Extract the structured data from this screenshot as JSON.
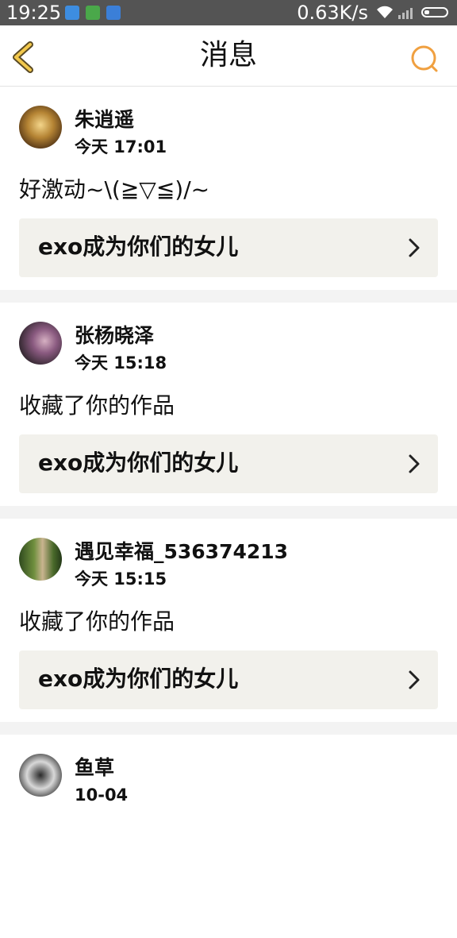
{
  "status_bar": {
    "time": "19:25",
    "speed": "0.63K/s",
    "icons": [
      "notification-app-icon",
      "notification-app-icon",
      "notification-shield-icon",
      "wifi-icon",
      "signal-icon",
      "battery-icon"
    ]
  },
  "header": {
    "title": "消息",
    "back_icon": "chevron-left-icon",
    "search_icon": "search-icon",
    "accent_color": "#f0a040"
  },
  "messages": [
    {
      "name": "朱逍遥",
      "time": "今天 17:01",
      "text": "好激动~\\(≧▽≦)/~",
      "work_title": "exo成为你们的女儿"
    },
    {
      "name": "张杨晓泽",
      "time": "今天 15:18",
      "text": "收藏了你的作品",
      "work_title": "exo成为你们的女儿"
    },
    {
      "name": "遇见幸福_536374213",
      "time": "今天 15:15",
      "text": "收藏了你的作品",
      "work_title": "exo成为你们的女儿"
    },
    {
      "name": "鱼草",
      "time": "10-04",
      "text": "",
      "work_title": ""
    }
  ]
}
